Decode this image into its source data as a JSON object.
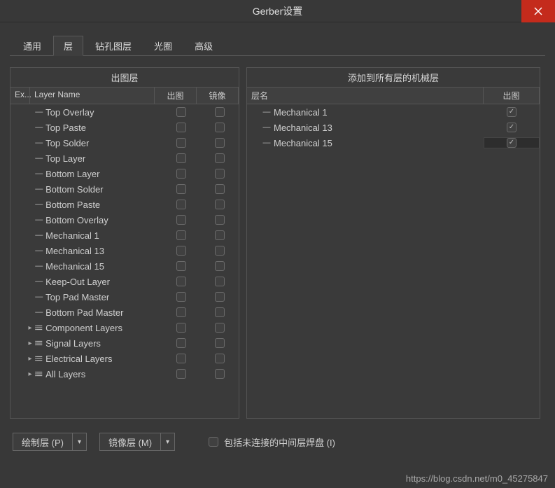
{
  "title": "Gerber设置",
  "tabs": [
    "通用",
    "层",
    "钻孔图层",
    "光圈",
    "高级"
  ],
  "active_tab": 1,
  "left_panel": {
    "title": "出图层",
    "headers": {
      "ex": "Ex...",
      "name": "Layer Name",
      "plot": "出图",
      "mirror": "镜像"
    },
    "rows": [
      {
        "name": "Top Overlay",
        "type": "leaf"
      },
      {
        "name": "Top Paste",
        "type": "leaf"
      },
      {
        "name": "Top Solder",
        "type": "leaf"
      },
      {
        "name": "Top Layer",
        "type": "leaf"
      },
      {
        "name": "Bottom Layer",
        "type": "leaf"
      },
      {
        "name": "Bottom Solder",
        "type": "leaf"
      },
      {
        "name": "Bottom Paste",
        "type": "leaf"
      },
      {
        "name": "Bottom Overlay",
        "type": "leaf"
      },
      {
        "name": "Mechanical 1",
        "type": "leaf"
      },
      {
        "name": "Mechanical 13",
        "type": "leaf"
      },
      {
        "name": "Mechanical 15",
        "type": "leaf"
      },
      {
        "name": "Keep-Out Layer",
        "type": "leaf"
      },
      {
        "name": "Top Pad Master",
        "type": "leaf"
      },
      {
        "name": "Bottom Pad Master",
        "type": "leaf"
      },
      {
        "name": "Component Layers",
        "type": "group"
      },
      {
        "name": "Signal Layers",
        "type": "group"
      },
      {
        "name": "Electrical Layers",
        "type": "group"
      },
      {
        "name": "All Layers",
        "type": "group"
      }
    ]
  },
  "right_panel": {
    "title": "添加到所有层的机械层",
    "headers": {
      "name": "层名",
      "plot": "出图"
    },
    "rows": [
      {
        "name": "Mechanical 1",
        "checked": true,
        "selected": false
      },
      {
        "name": "Mechanical 13",
        "checked": true,
        "selected": false
      },
      {
        "name": "Mechanical 15",
        "checked": true,
        "selected": true
      }
    ]
  },
  "bottom": {
    "plot_layers_btn": "绘制层 (P)",
    "mirror_layers_btn": "镜像层 (M)",
    "include_unconnected": "包括未连接的中间层焊盘 (I)"
  },
  "watermark": "https://blog.csdn.net/m0_45275847"
}
